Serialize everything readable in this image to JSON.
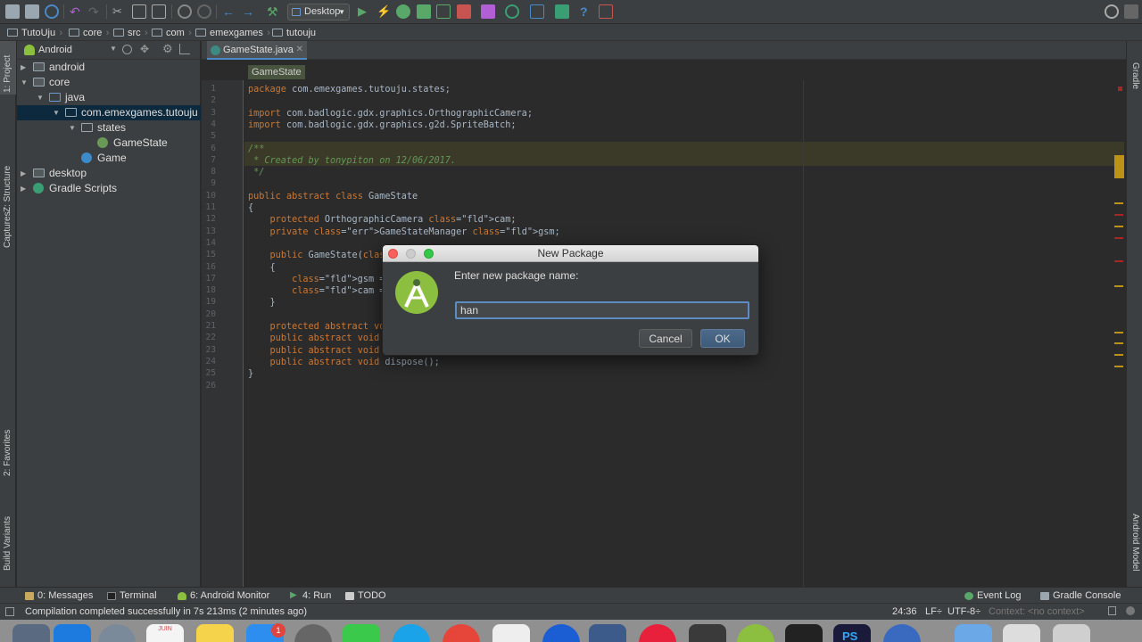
{
  "toolbar": {
    "run_config": "Desktop"
  },
  "breadcrumb": [
    "TutoUju",
    "core",
    "src",
    "com",
    "emexgames",
    "tutouju"
  ],
  "left_tool_tabs": {
    "project": "1: Project",
    "structure": "Z: Structure",
    "captures": "Captures",
    "favorites": "2: Favorites",
    "build_variants": "Build Variants"
  },
  "right_tool_tabs": {
    "gradle": "Gradle",
    "android_model": "Android Model"
  },
  "project_panel": {
    "view_mode": "Android",
    "tree": [
      {
        "label": "android",
        "depth": 0,
        "type": "module",
        "expanded": false
      },
      {
        "label": "core",
        "depth": 0,
        "type": "module",
        "expanded": true
      },
      {
        "label": "java",
        "depth": 1,
        "type": "folder",
        "expanded": true
      },
      {
        "label": "com.emexgames.tutouju",
        "depth": 2,
        "type": "package",
        "expanded": true,
        "selected": true
      },
      {
        "label": "states",
        "depth": 3,
        "type": "package",
        "expanded": true
      },
      {
        "label": "GameState",
        "depth": 4,
        "type": "abstract-class"
      },
      {
        "label": "Game",
        "depth": 3,
        "type": "class"
      },
      {
        "label": "desktop",
        "depth": 0,
        "type": "module",
        "expanded": false
      },
      {
        "label": "Gradle Scripts",
        "depth": 0,
        "type": "gradle",
        "expanded": false
      }
    ]
  },
  "editor": {
    "tab": "GameState.java",
    "class_breadcrumb": "GameState",
    "lines": [
      "package com.emexgames.tutouju.states;",
      "",
      "import com.badlogic.gdx.graphics.OrthographicCamera;",
      "import com.badlogic.gdx.graphics.g2d.SpriteBatch;",
      "",
      "/**",
      " * Created by tonypiton on 12/06/2017.",
      " */",
      "",
      "public abstract class GameState",
      "{",
      "    protected OrthographicCamera cam;",
      "    private GameStateManager gsm;",
      "",
      "    public GameState(GameStateManager gsm)",
      "    {",
      "        gsm = gsm;",
      "        cam = new OrthographicCamera();",
      "    }",
      "",
      "    protected abstract void handleInput();",
      "    public abstract void update(float dt);",
      "    public abstract void render(SpriteBatch sb);",
      "    public abstract void dispose();",
      "}",
      ""
    ]
  },
  "dialog": {
    "title": "New Package",
    "label": "Enter new package name:",
    "input_value": "han",
    "cancel": "Cancel",
    "ok": "OK"
  },
  "bottom_tabs": {
    "messages": "0: Messages",
    "terminal": "Terminal",
    "android_monitor": "6: Android Monitor",
    "run": "4: Run",
    "todo": "TODO",
    "event_log": "Event Log",
    "gradle_console": "Gradle Console"
  },
  "status_bar": {
    "message": "Compilation completed successfully in 7s 213ms (2 minutes ago)",
    "position": "24:36",
    "line_sep": "LF÷",
    "encoding": "UTF-8÷",
    "context": "Context: <no context>"
  },
  "dock": {
    "calendar_month": "JUIN",
    "badge": "1",
    "ps": "PS"
  },
  "colors": {
    "ide_bg": "#2b2b2b",
    "panel_bg": "#3c3f41",
    "selection": "#0d293e",
    "android_green": "#8cbf3f"
  }
}
